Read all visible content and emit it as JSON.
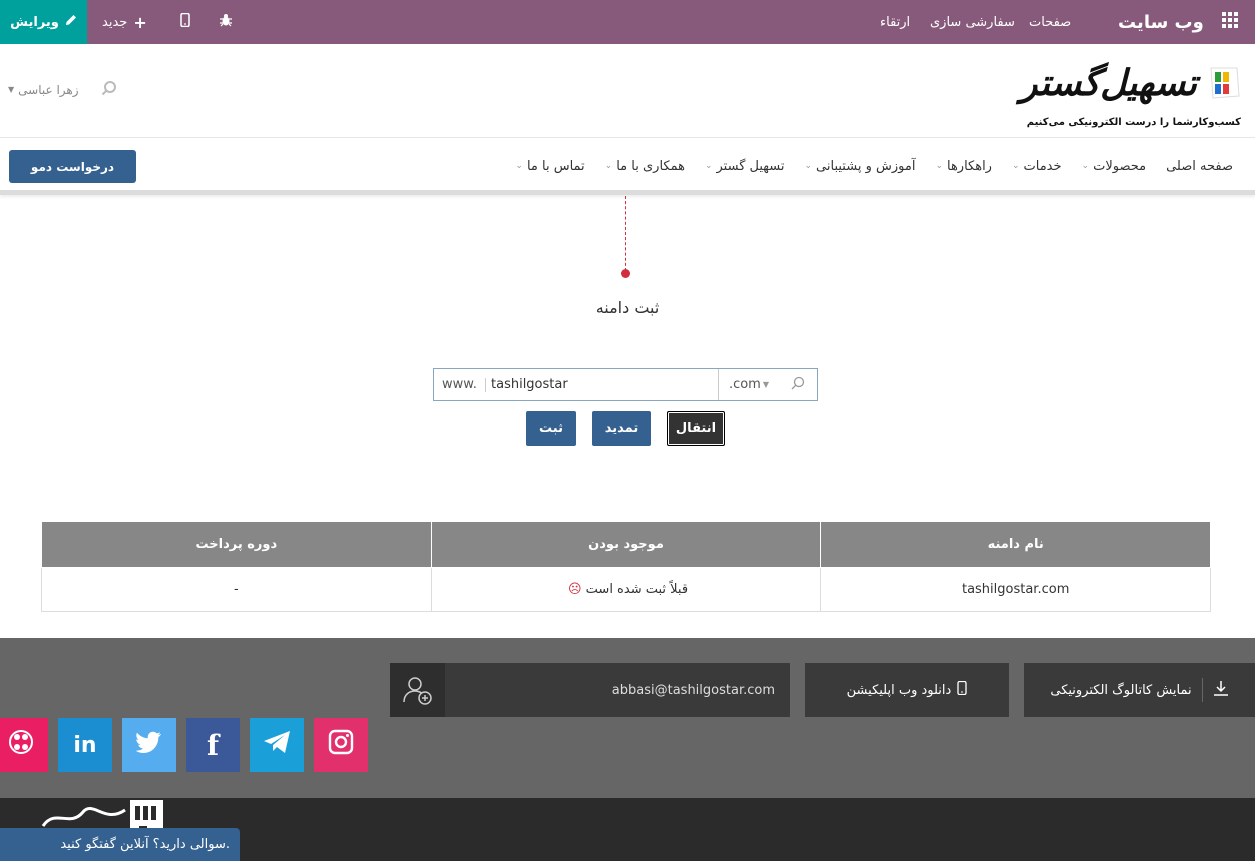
{
  "topbar": {
    "edit_label": "ویرایش",
    "new_label": "جدید",
    "title": "وب سایت",
    "menu": [
      "صفحات",
      "سفارشی سازی",
      "ارتقاء"
    ],
    "mobile_icon": "mobile-icon",
    "debug_icon": "bug-icon",
    "apps_icon": "grid-icon"
  },
  "header": {
    "logo_name": "تسهیل‌گستر",
    "logo_tagline": "کسب‌وکارشما را درست الکترونیکی می‌کنیم",
    "user_name": "زهرا عباسی"
  },
  "nav": {
    "items": [
      {
        "label": "صفحه اصلی",
        "dropdown": false
      },
      {
        "label": "محصولات",
        "dropdown": true
      },
      {
        "label": "خدمات",
        "dropdown": true
      },
      {
        "label": "راهکارها",
        "dropdown": true
      },
      {
        "label": "آموزش و پشتیبانی",
        "dropdown": true
      },
      {
        "label": "تسهیل گستر",
        "dropdown": true
      },
      {
        "label": "همکاری با ما",
        "dropdown": true
      },
      {
        "label": "تماس با ما",
        "dropdown": true
      }
    ],
    "demo_button": "درخواست دمو"
  },
  "domain": {
    "title": "ثبت دامنه",
    "prefix": "www.",
    "value": "tashilgostar",
    "tld": ".com",
    "buttons": {
      "register": "ثبت",
      "renew": "تمدید",
      "transfer": "انتقال"
    }
  },
  "table": {
    "headers": [
      "نام دامنه",
      "موجود بودن",
      "دوره پرداخت"
    ],
    "rows": [
      {
        "name": "tashilgostar.com",
        "availability": "قبلاً ثبت شده است",
        "period": "-"
      }
    ]
  },
  "footer": {
    "email": "abbasi@tashilgostar.com",
    "app_download": "دانلود وب اپلیکیشن",
    "catalog": "نمایش کاتالوگ الکترونیکی",
    "social": [
      {
        "name": "aparat",
        "color": "#e91e63"
      },
      {
        "name": "linkedin",
        "color": "#1a8ed1"
      },
      {
        "name": "twitter",
        "color": "#55acee"
      },
      {
        "name": "facebook",
        "color": "#3b5998"
      },
      {
        "name": "telegram",
        "color": "#1a9fd8"
      },
      {
        "name": "instagram",
        "color": "#e1306c"
      }
    ]
  },
  "chat": {
    "label": "سوالی دارید؟ آنلاین گفتگو کنید."
  },
  "colors": {
    "admin_bar": "#875a7b",
    "edit": "#00a09d",
    "primary": "#34618f",
    "accent": "#d12d3e"
  }
}
